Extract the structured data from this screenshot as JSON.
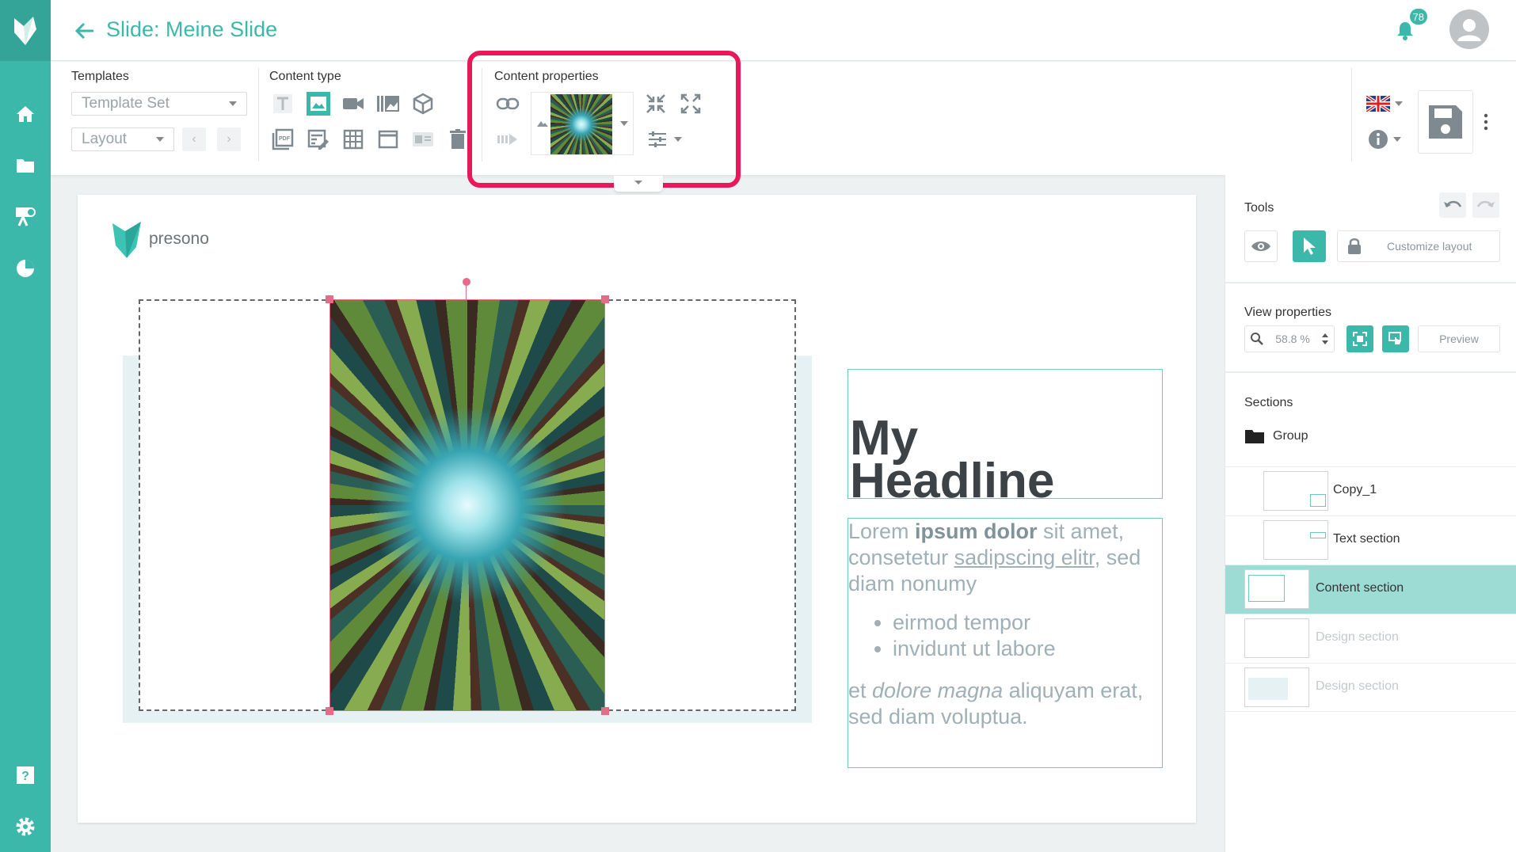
{
  "header": {
    "title": "Slide: Meine Slide",
    "notification_count": "78"
  },
  "toolbar": {
    "templates_label": "Templates",
    "template_set": "Template Set",
    "layout": "Layout",
    "content_type_label": "Content type",
    "content_properties_label": "Content properties",
    "colors": {
      "accent": "#3cb8aa",
      "highlight": "#e8185b"
    }
  },
  "right_panel": {
    "tools_label": "Tools",
    "customize_layout": "Customize layout",
    "view_properties_label": "View properties",
    "zoom": "58.8 %",
    "preview": "Preview",
    "sections_label": "Sections",
    "group_name": "Group",
    "sections": [
      {
        "name": "Copy_1"
      },
      {
        "name": "Text section"
      },
      {
        "name": "Content section"
      },
      {
        "name": "Design section"
      },
      {
        "name": "Design section"
      }
    ]
  },
  "slide": {
    "brand": "presono",
    "headline_line1": "My",
    "headline_line2": "Headline",
    "body": {
      "p1_a": "Lorem ",
      "p1_b": "ipsum dolor",
      "p1_c": " sit amet, consetetur ",
      "p1_d": "sadipscing elitr",
      "p1_e": ", sed diam nonumy",
      "bullets": [
        "eirmod tempor",
        "invidunt ut labore"
      ],
      "p2_a": "et ",
      "p2_b": "dolore magna",
      "p2_c": " aliquyam erat, sed diam voluptua."
    }
  }
}
